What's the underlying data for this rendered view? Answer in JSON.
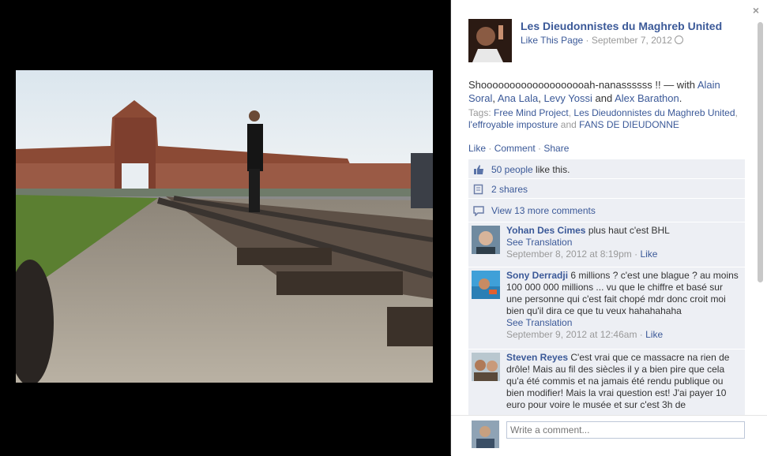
{
  "post": {
    "page_name": "Les Dieudonnistes du Maghreb United",
    "like_page": "Like This Page",
    "date": "September 7, 2012",
    "caption_text": "Shooooooooooooooooooah-nanassssss !! — with ",
    "with_people": [
      "Alain Soral",
      "Ana Lala",
      "Levy Yossi",
      "Alex Barathon"
    ],
    "tags_label": "Tags: ",
    "tags": [
      "Free Mind Project",
      "Les Dieudonnistes du Maghreb United",
      "l'effroyable imposture",
      "FANS DE DIEUDONNE"
    ],
    "actions": [
      "Like",
      "Comment",
      "Share"
    ]
  },
  "summary": {
    "likes_link": "50 people",
    "likes_suffix": " like this.",
    "shares": "2 shares",
    "more_comments": "View 13 more comments"
  },
  "comments": [
    {
      "author": "Yohan Des Cimes",
      "text": " plus haut c'est BHL",
      "translate": "See Translation",
      "time": "September 8, 2012 at 8:19pm",
      "like": "Like"
    },
    {
      "author": "Sony Derradji",
      "text": " 6 millions ? c'est une blague ? au moins 100 000 000 millions ... vu que le chiffre et basé sur une personne qui c'est fait chopé mdr donc croit moi bien qu'il dira ce que tu veux hahahahaha",
      "translate": "See Translation",
      "time": "September 9, 2012 at 12:46am",
      "like": "Like"
    },
    {
      "author": "Steven Reyes",
      "text": " C'est vrai que ce massacre na rien de drôle! Mais au fil des siècles il y a bien pire que cela qu'a été commis et na jamais été rendu publique ou bien modifier! Mais la vrai question est! J'ai payer 10 euro pour voire le musée et sur c'est 3h de",
      "translate": "",
      "time": "",
      "like": ""
    }
  ],
  "compose": {
    "placeholder": "Write a comment..."
  },
  "close_symbol": "×",
  "separator": " · ",
  "colors": {
    "link": "#3b5998",
    "panel_row": "#edeff4",
    "meta": "#999999"
  }
}
